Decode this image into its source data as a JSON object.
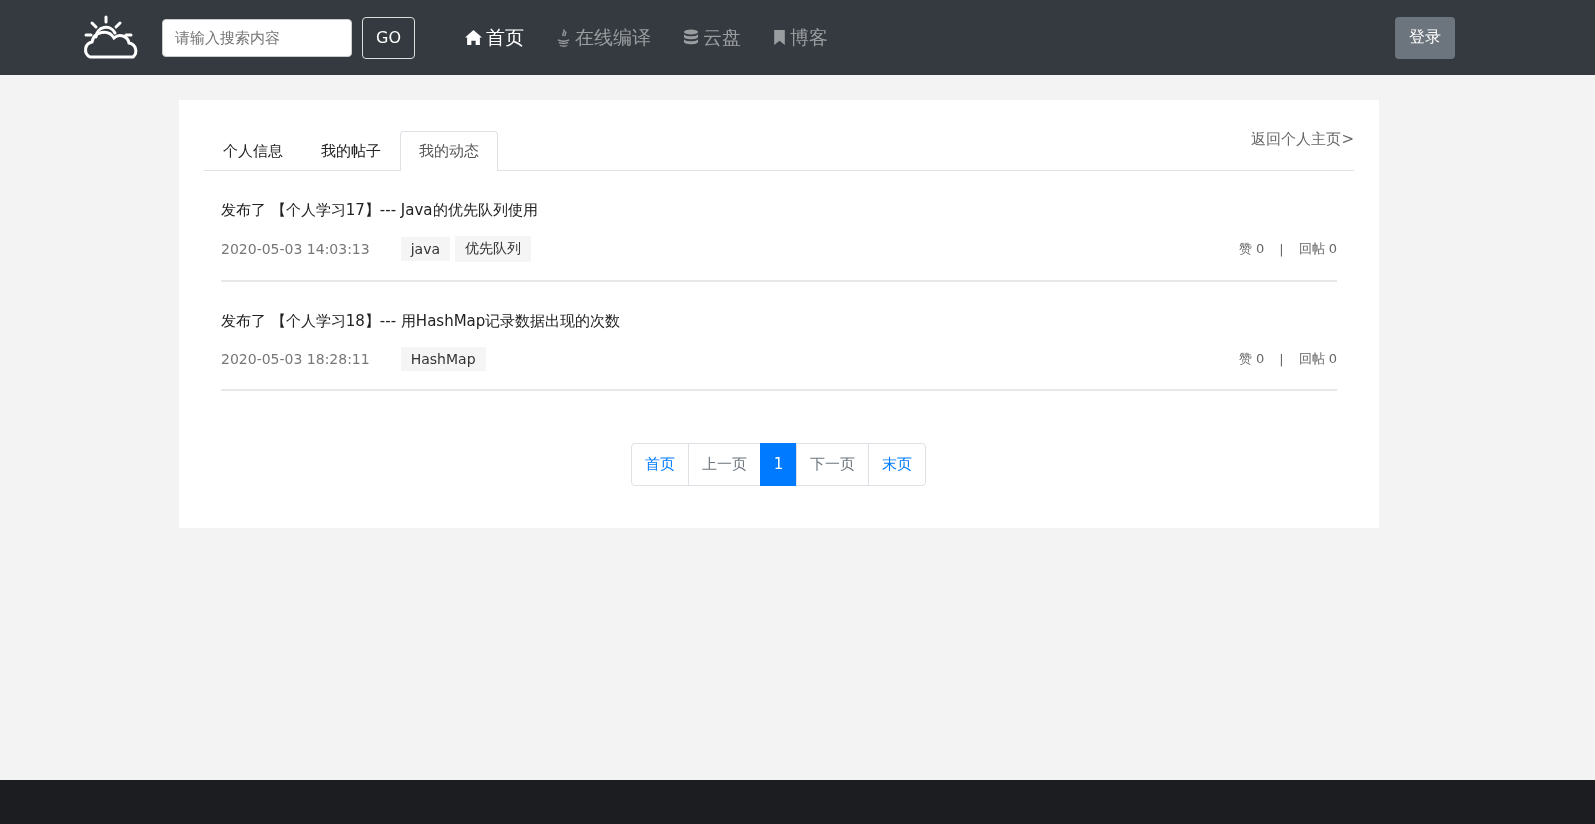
{
  "navbar": {
    "search": {
      "placeholder": "请输入搜索内容"
    },
    "go_button": "GO",
    "nav_items": [
      {
        "label": "首页",
        "kind": "home",
        "selected": true
      },
      {
        "label": "在线编译",
        "kind": "compile",
        "selected": false
      },
      {
        "label": "云盘",
        "kind": "disk",
        "selected": false
      },
      {
        "label": "博客",
        "kind": "blog",
        "selected": false
      }
    ],
    "login_button": "登录"
  },
  "tabs": [
    {
      "label": "个人信息",
      "selected": false
    },
    {
      "label": "我的帖子",
      "selected": false
    },
    {
      "label": "我的动态",
      "selected": true
    }
  ],
  "back_link": "返回个人主页>",
  "posts": [
    {
      "title": "发布了 【个人学习17】--- Java的优先队列使用",
      "time": "2020-05-03 14:03:13",
      "tags": [
        "java",
        "优先队列"
      ],
      "likes": "赞 0",
      "separator": "|",
      "replies": "回帖 0"
    },
    {
      "title": "发布了 【个人学习18】--- 用HashMap记录数据出现的次数",
      "time": "2020-05-03 18:28:11",
      "tags": [
        "HashMap"
      ],
      "likes": "赞 0",
      "separator": "|",
      "replies": "回帖 0"
    }
  ],
  "pagination": [
    {
      "label": "首页",
      "selected": false,
      "disabled": false
    },
    {
      "label": "上一页",
      "selected": false,
      "disabled": true
    },
    {
      "label": "1",
      "selected": true,
      "disabled": false
    },
    {
      "label": "下一页",
      "selected": false,
      "disabled": true
    },
    {
      "label": "末页",
      "selected": false,
      "disabled": false
    }
  ]
}
